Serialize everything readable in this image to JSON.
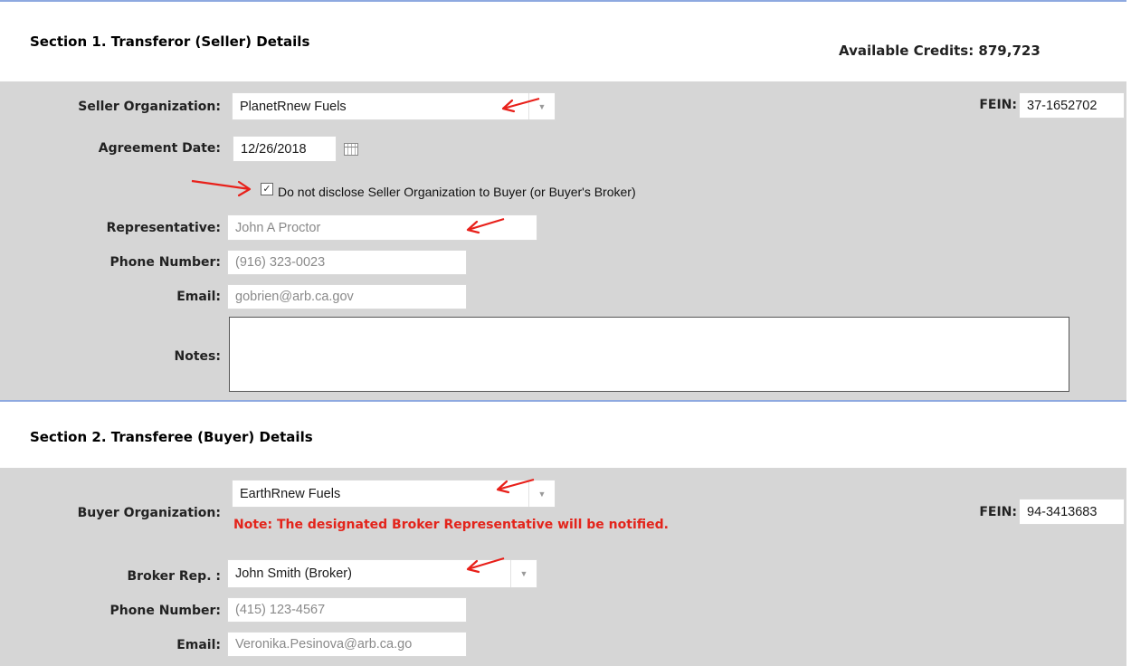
{
  "section1": {
    "title": "Section 1. Transferor (Seller) Details",
    "available_credits": "Available Credits: 879,723",
    "seller_org_label": "Seller Organization:",
    "seller_org_value": "PlanetRnew Fuels",
    "fein_label": "FEIN:",
    "fein_value": "37-1652702",
    "agreement_date_label": "Agreement Date:",
    "agreement_date_value": "12/26/2018",
    "disclose_checkbox_label": "Do not disclose Seller Organization to Buyer (or Buyer's Broker)",
    "disclose_checked": true,
    "representative_label": "Representative:",
    "representative_value": "John A Proctor",
    "phone_label": "Phone Number:",
    "phone_value": "(916) 323-0023",
    "email_label": "Email:",
    "email_value": "gobrien@arb.ca.gov",
    "notes_label": "Notes:",
    "notes_value": ""
  },
  "section2": {
    "title": "Section 2. Transferee (Buyer) Details",
    "buyer_org_label": "Buyer Organization:",
    "buyer_org_value": "EarthRnew Fuels",
    "broker_note": "Note: The designated Broker Representative will be notified.",
    "fein_label": "FEIN:",
    "fein_value": "94-3413683",
    "broker_rep_label": "Broker Rep. :",
    "broker_rep_value": "John Smith  (Broker)",
    "phone_label": "Phone Number:",
    "phone_value": "(415) 123-4567",
    "email_label": "Email:",
    "email_value": "Veronika.Pesinova@arb.ca.go"
  },
  "icons": {
    "dropdown": "chevron-down-icon",
    "calendar": "calendar-icon",
    "annotation": "red-arrow-icon"
  },
  "colors": {
    "panel_bg": "#d6d6d6",
    "divider": "#8ea9e0",
    "note_red": "#e3241b",
    "arrow_red": "#e8201a"
  }
}
